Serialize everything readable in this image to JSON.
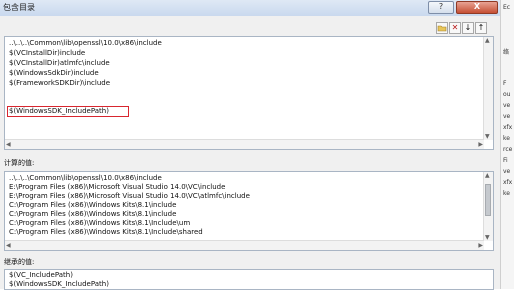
{
  "window": {
    "title": "包含目录",
    "help_label": "?",
    "close_label": "X"
  },
  "toolbar": {
    "folder_icon": "folder-icon",
    "delete_icon": "delete-icon",
    "down_icon": "move-down-icon",
    "up_icon": "move-up-icon",
    "delete_label": "✕",
    "down_label": "↓",
    "up_label": "↑"
  },
  "edit_lines": [
    "..\\..\\..\\Common\\lib\\openssl\\10.0\\x86\\include",
    "$(VCInstallDir)include",
    "$(VCInstallDir)atlmfc\\include",
    "$(WindowsSdkDir)include",
    "$(FrameworkSDKDir)\\include",
    "$(WindowsSDK_IncludePath)"
  ],
  "calc_label": "计算的值:",
  "calc_lines": [
    "..\\..\\..\\Common\\lib\\openssl\\10.0\\x86\\include",
    "E:\\Program Files (x86)\\Microsoft Visual Studio 14.0\\VC\\include",
    "E:\\Program Files (x86)\\Microsoft Visual Studio 14.0\\VC\\atlmfc\\include",
    "C:\\Program Files (x86)\\Windows Kits\\8.1\\include",
    "C:\\Program Files (x86)\\Windows Kits\\8.1\\include",
    "C:\\Program Files (x86)\\Windows Kits\\8.1\\Include\\um",
    "C:\\Program Files (x86)\\Windows Kits\\8.1\\Include\\shared"
  ],
  "inherited_label": "继承的值:",
  "inherited_lines": [
    "$(VC_IncludePath)",
    "$(WindowsSDK_IncludePath)"
  ],
  "right_strip": [
    "Ec",
    "络",
    "F",
    "ou",
    "ve",
    "ve",
    "xfx",
    "ke",
    "rce",
    "Fi",
    "ve",
    "xfx",
    "ke"
  ]
}
